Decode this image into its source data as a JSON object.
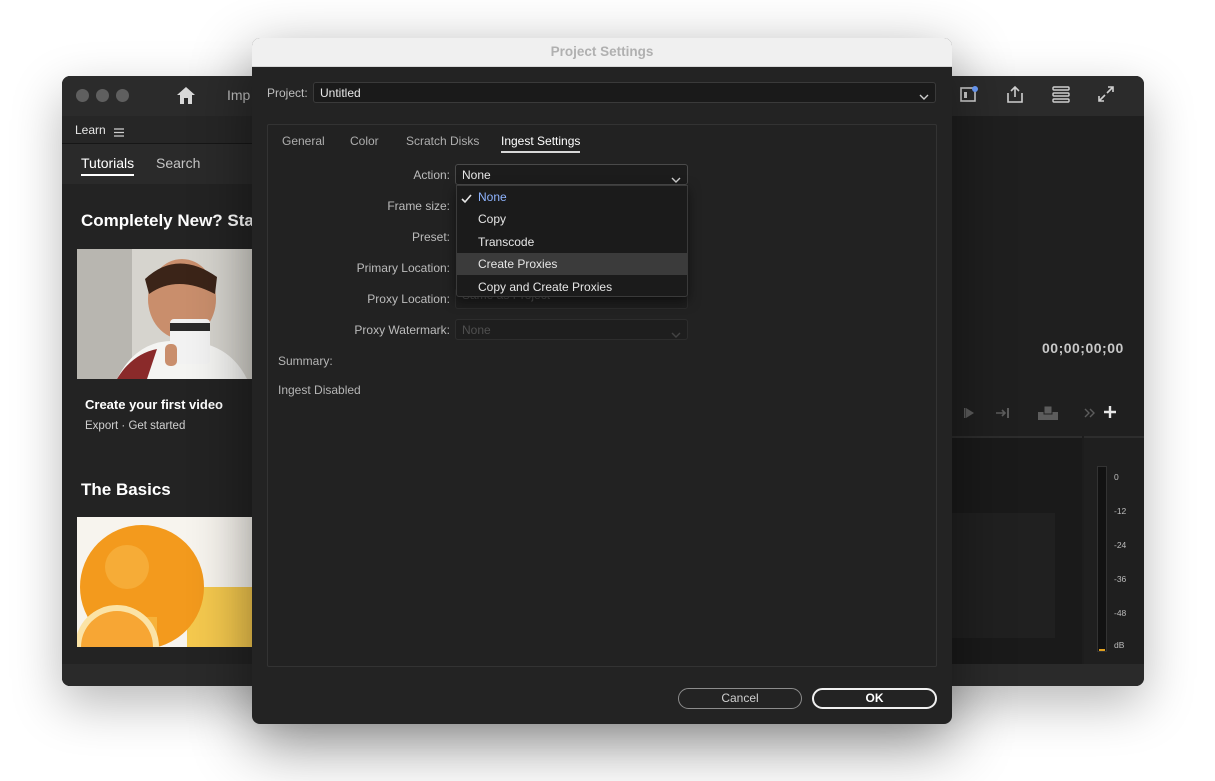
{
  "app": {
    "nav_import_partial": "Imp",
    "learn_label": "Learn",
    "tabs": [
      {
        "label": "Tutorials"
      },
      {
        "label": "Search"
      }
    ],
    "heading_new": "Completely New? Star",
    "card_title": "Create your first video",
    "card_subtitle": "Export · Get started",
    "heading_basics": "The Basics",
    "timecode": "00;00;00;00",
    "meter_labels": [
      "0",
      "-12",
      "-24",
      "-36",
      "-48",
      "dB"
    ],
    "icons": [
      "home-icon",
      "panel-layout-icon",
      "share-icon",
      "list-settings-icon",
      "fullscreen-icon",
      "play-icon",
      "insert-icon",
      "overwrite-icon",
      "more-icon",
      "add-icon"
    ]
  },
  "dialog": {
    "title": "Project Settings",
    "project_label": "Project:",
    "project_value": "Untitled",
    "tabs": [
      {
        "label": "General",
        "active": false
      },
      {
        "label": "Color",
        "active": false
      },
      {
        "label": "Scratch Disks",
        "active": false
      },
      {
        "label": "Ingest Settings",
        "active": true
      }
    ],
    "form": {
      "action_label": "Action:",
      "action_value": "None",
      "frame_size_label": "Frame size:",
      "preset_label": "Preset:",
      "primary_location_label": "Primary Location:",
      "proxy_location_label": "Proxy Location:",
      "proxy_location_value": "Same as Project",
      "proxy_watermark_label": "Proxy Watermark:",
      "proxy_watermark_value": "None"
    },
    "action_menu": {
      "items": [
        {
          "label": "None",
          "checked": true
        },
        {
          "label": "Copy",
          "checked": false
        },
        {
          "label": "Transcode",
          "checked": false
        },
        {
          "label": "Create Proxies",
          "checked": false,
          "hovered": true
        },
        {
          "label": "Copy and Create Proxies",
          "checked": false
        }
      ]
    },
    "summary_label": "Summary:",
    "summary_value": "Ingest Disabled",
    "cancel_label": "Cancel",
    "ok_label": "OK"
  },
  "colors": {
    "dialog_bg": "#232323",
    "menu_hover": "#3b3b3b",
    "checked_item": "#8fb4ff"
  }
}
